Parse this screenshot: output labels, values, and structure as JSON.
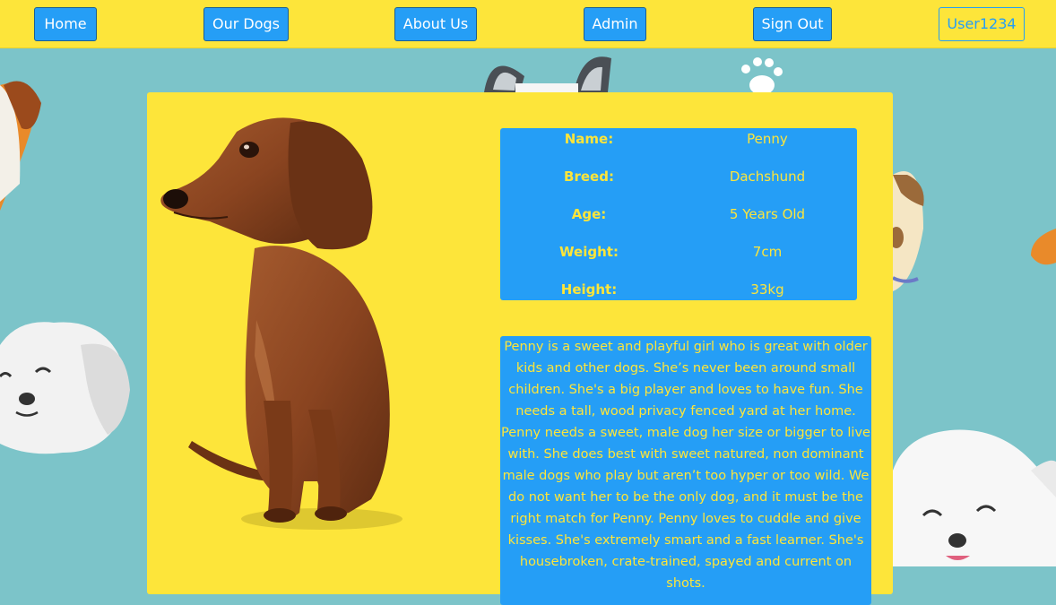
{
  "nav": {
    "home": "Home",
    "our_dogs": "Our Dogs",
    "about_us": "About Us",
    "admin": "Admin",
    "sign_out": "Sign Out",
    "user": "User1234"
  },
  "dog": {
    "fields": [
      {
        "label": "Name:",
        "value": "Penny"
      },
      {
        "label": "Breed:",
        "value": "Dachshund"
      },
      {
        "label": "Age:",
        "value": "5 Years Old"
      },
      {
        "label": "Weight:",
        "value": "7cm"
      },
      {
        "label": "Height:",
        "value": "33kg"
      }
    ],
    "bio": "Penny is a sweet and playful girl who is great with older kids and other dogs. She’s never been around small children. She's a big player and loves to have fun. She needs a tall, wood privacy fenced yard at her home. Penny needs a sweet, male dog her size or bigger to live with. She does best with sweet natured, non dominant male dogs who play but aren’t too hyper or too wild. We do not want her to be the only dog, and it must be the right match for Penny. Penny loves to cuddle and give kisses. She's extremely smart and a fast learner. She's housebroken, crate-trained, spayed and current on shots."
  },
  "colors": {
    "nav_background": "#fde53a",
    "button_blue": "#259ef6",
    "page_background": "#7cc4c9",
    "text_yellow": "#fde53a"
  }
}
